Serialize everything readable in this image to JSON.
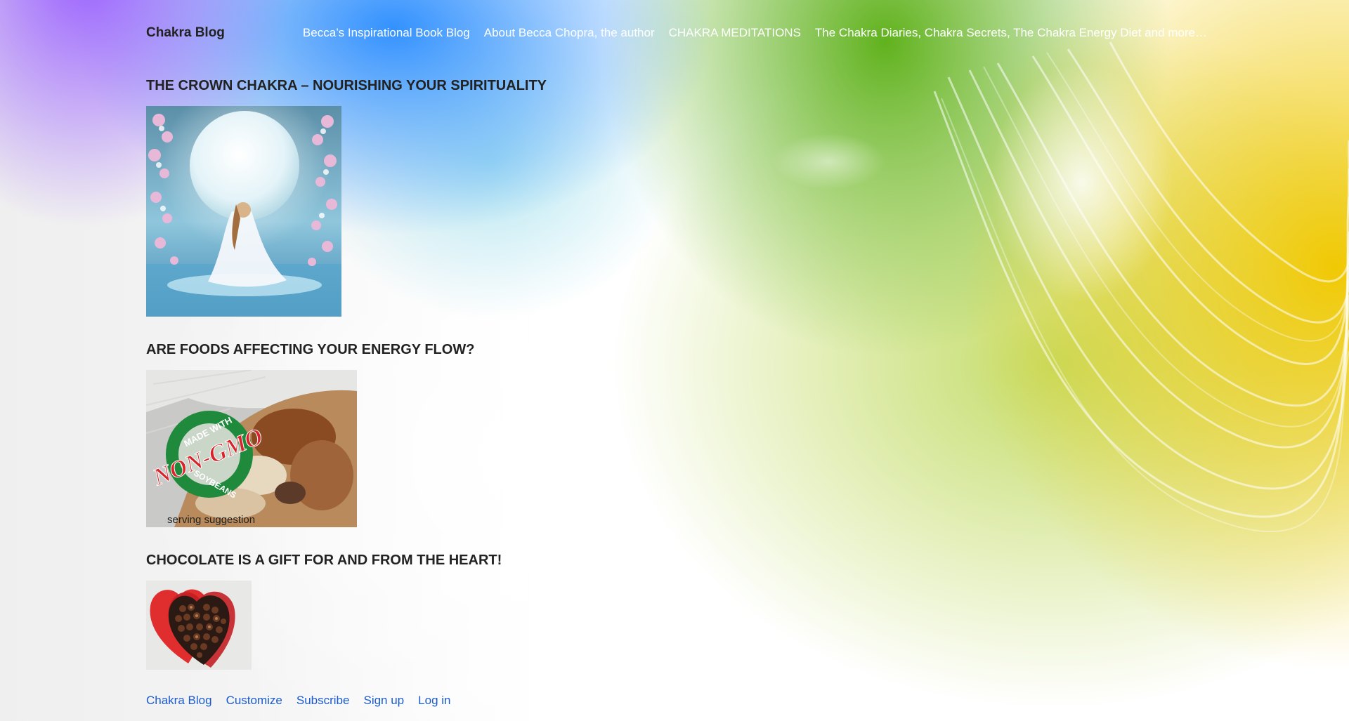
{
  "site": {
    "title": "Chakra Blog"
  },
  "nav": {
    "items": [
      {
        "label": "Becca’s Inspirational Book Blog"
      },
      {
        "label": "About Becca Chopra, the author"
      },
      {
        "label": "CHAKRA MEDITATIONS"
      },
      {
        "label": "The Chakra Diaries, Chakra Secrets, The Chakra Energy Diet and more…"
      }
    ]
  },
  "posts": [
    {
      "title": "THE CROWN CHAKRA – NOURISHING YOUR SPIRITUALITY"
    },
    {
      "title": "ARE FOODS AFFECTING YOUR ENERGY FLOW?",
      "image_text": {
        "badge_top": "MADE WITH",
        "badge_main": "NON-GMO",
        "badge_bottom": "SOYBEANS",
        "caption": "serving suggestion"
      }
    },
    {
      "title": "CHOCOLATE IS A GIFT FOR AND FROM THE HEART!"
    }
  ],
  "footer": {
    "links": [
      {
        "label": "Chakra Blog"
      },
      {
        "label": "Customize"
      },
      {
        "label": "Subscribe"
      },
      {
        "label": "Sign up"
      },
      {
        "label": "Log in"
      }
    ]
  },
  "colors": {
    "link": "#1a5bd0",
    "title": "#222222",
    "nav": "#ffffff"
  }
}
